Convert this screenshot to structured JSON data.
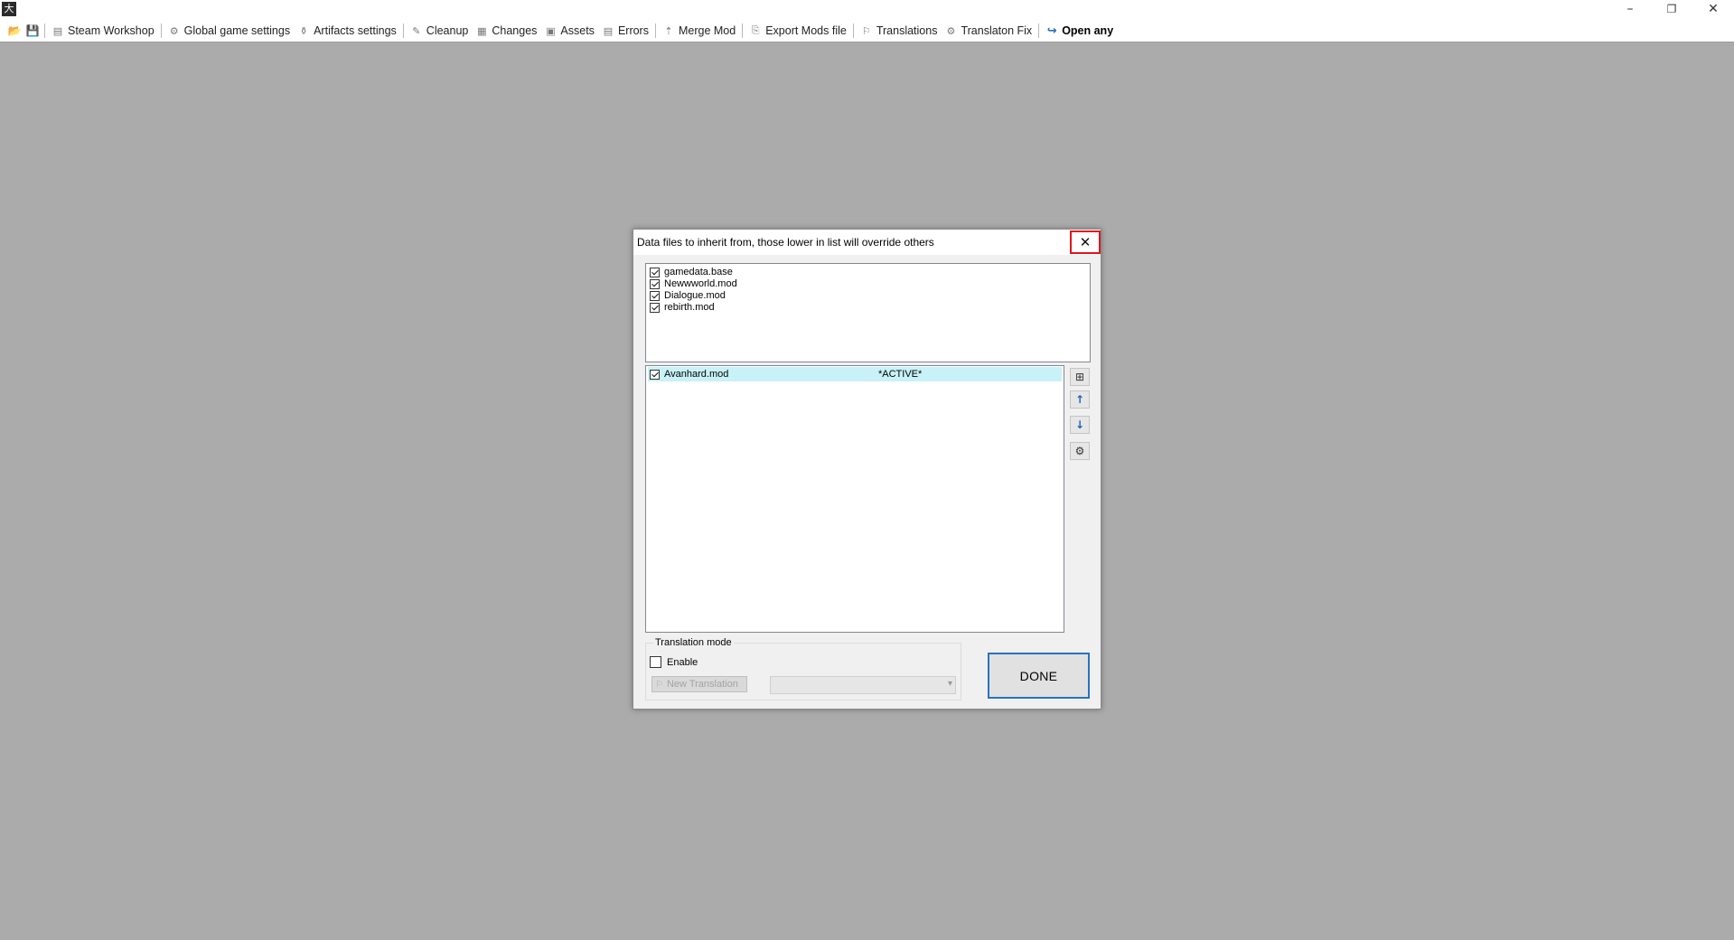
{
  "window": {
    "app_icon_glyph": "大",
    "controls": {
      "minimize": "–",
      "restore": "❐",
      "close": "✕"
    }
  },
  "toolbar": {
    "items": [
      {
        "label": "Steam Workshop",
        "icon": "workshop-icon",
        "glyph": "▤"
      },
      {
        "label": "Global game settings",
        "icon": "gear-icon",
        "glyph": "⚙"
      },
      {
        "label": "Artifacts settings",
        "icon": "artifact-icon",
        "glyph": "⚱"
      },
      {
        "label": "Cleanup",
        "icon": "broom-icon",
        "glyph": "✎"
      },
      {
        "label": "Changes",
        "icon": "changes-icon",
        "glyph": "▦"
      },
      {
        "label": "Assets",
        "icon": "assets-icon",
        "glyph": "▣"
      },
      {
        "label": "Errors",
        "icon": "errors-icon",
        "glyph": "▤"
      },
      {
        "label": "Merge Mod",
        "icon": "merge-icon",
        "glyph": "⇡"
      },
      {
        "label": "Export Mods file",
        "icon": "export-icon",
        "glyph": "⎘"
      },
      {
        "label": "Translations",
        "icon": "translate-icon",
        "glyph": "⚐"
      },
      {
        "label": "Translaton Fix",
        "icon": "translate-fix-icon",
        "glyph": "⚙"
      },
      {
        "label": "Open any",
        "icon": "open-any-icon",
        "glyph": "↪"
      }
    ]
  },
  "dialog": {
    "title": "Data files to inherit from, those lower in list will override others",
    "close_glyph": "✕",
    "inherited": [
      {
        "label": "gamedata.base",
        "checked": true
      },
      {
        "label": "Newwworld.mod",
        "checked": true
      },
      {
        "label": "Dialogue.mod",
        "checked": true
      },
      {
        "label": "rebirth.mod",
        "checked": true
      }
    ],
    "mods": [
      {
        "label": "Avanhard.mod",
        "checked": true,
        "tag": "*ACTIVE*"
      }
    ],
    "side_buttons": [
      {
        "name": "add-file-button",
        "glyph": "⊞"
      },
      {
        "name": "move-up-button",
        "glyph": "↑"
      },
      {
        "name": "move-down-button",
        "glyph": "↓"
      },
      {
        "name": "settings-button",
        "glyph": "⚙"
      }
    ],
    "translation_mode": {
      "legend": "Translation mode",
      "enable_label": "Enable",
      "enabled": false,
      "new_translation_label": "New Translation",
      "combo_value": ""
    },
    "done_label": "DONE"
  }
}
